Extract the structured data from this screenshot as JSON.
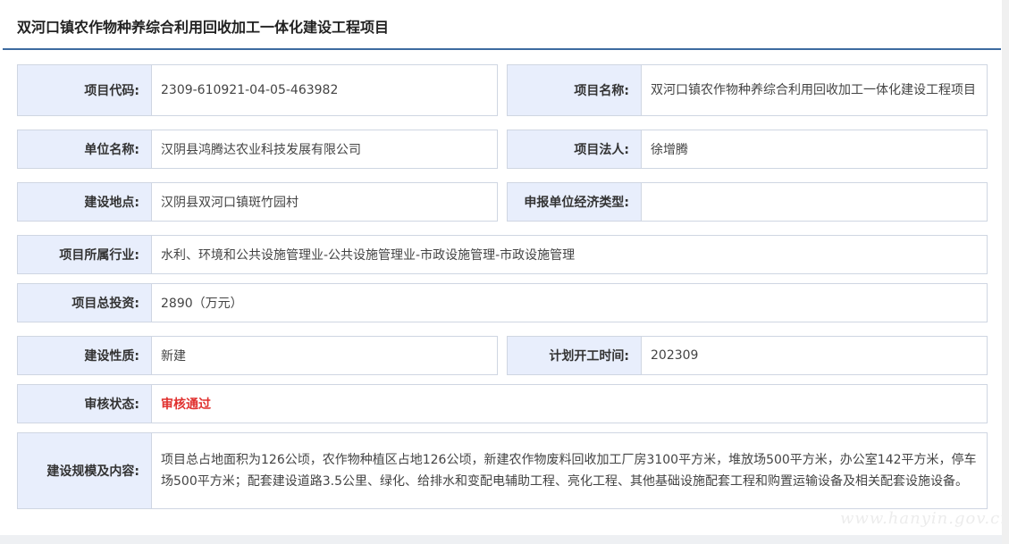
{
  "page": {
    "title": "双河口镇农作物种养综合利用回收加工一体化建设工程项目",
    "watermark": "www.hanyin.gov.cn"
  },
  "fields": {
    "project_code": {
      "label": "项目代码:",
      "value": "2309-610921-04-05-463982"
    },
    "project_name": {
      "label": "项目名称:",
      "value": "双河口镇农作物种养综合利用回收加工一体化建设工程项目"
    },
    "unit_name": {
      "label": "单位名称:",
      "value": "汉阴县鸿腾达农业科技发展有限公司"
    },
    "legal_person": {
      "label": "项目法人:",
      "value": "徐增腾"
    },
    "location": {
      "label": "建设地点:",
      "value": "汉阴县双河口镇斑竹园村"
    },
    "economic_type": {
      "label": "申报单位经济类型:",
      "value": ""
    },
    "industry": {
      "label": "项目所属行业:",
      "value": "水利、环境和公共设施管理业-公共设施管理业-市政设施管理-市政设施管理"
    },
    "total_investment": {
      "label": "项目总投资:",
      "value": "2890（万元）"
    },
    "nature": {
      "label": "建设性质:",
      "value": "新建"
    },
    "start_time": {
      "label": "计划开工时间:",
      "value": "202309"
    },
    "review_status": {
      "label": "审核状态:",
      "value": "审核通过"
    },
    "scale_content": {
      "label": "建设规模及内容:",
      "value": "项目总占地面积为126公顷，农作物种植区占地126公顷，新建农作物废料回收加工厂房3100平方米，堆放场500平方米，办公室142平方米，停车场500平方米；配套建设道路3.5公里、绿化、给排水和变配电辅助工程、亮化工程、其他基础设施配套工程和购置运输设备及相关配套设施设备。"
    }
  },
  "colors": {
    "label_bg": "#e8eefc",
    "border": "#cfd6e2",
    "title_rule": "#3d6ba0",
    "approved": "#e0302e"
  }
}
